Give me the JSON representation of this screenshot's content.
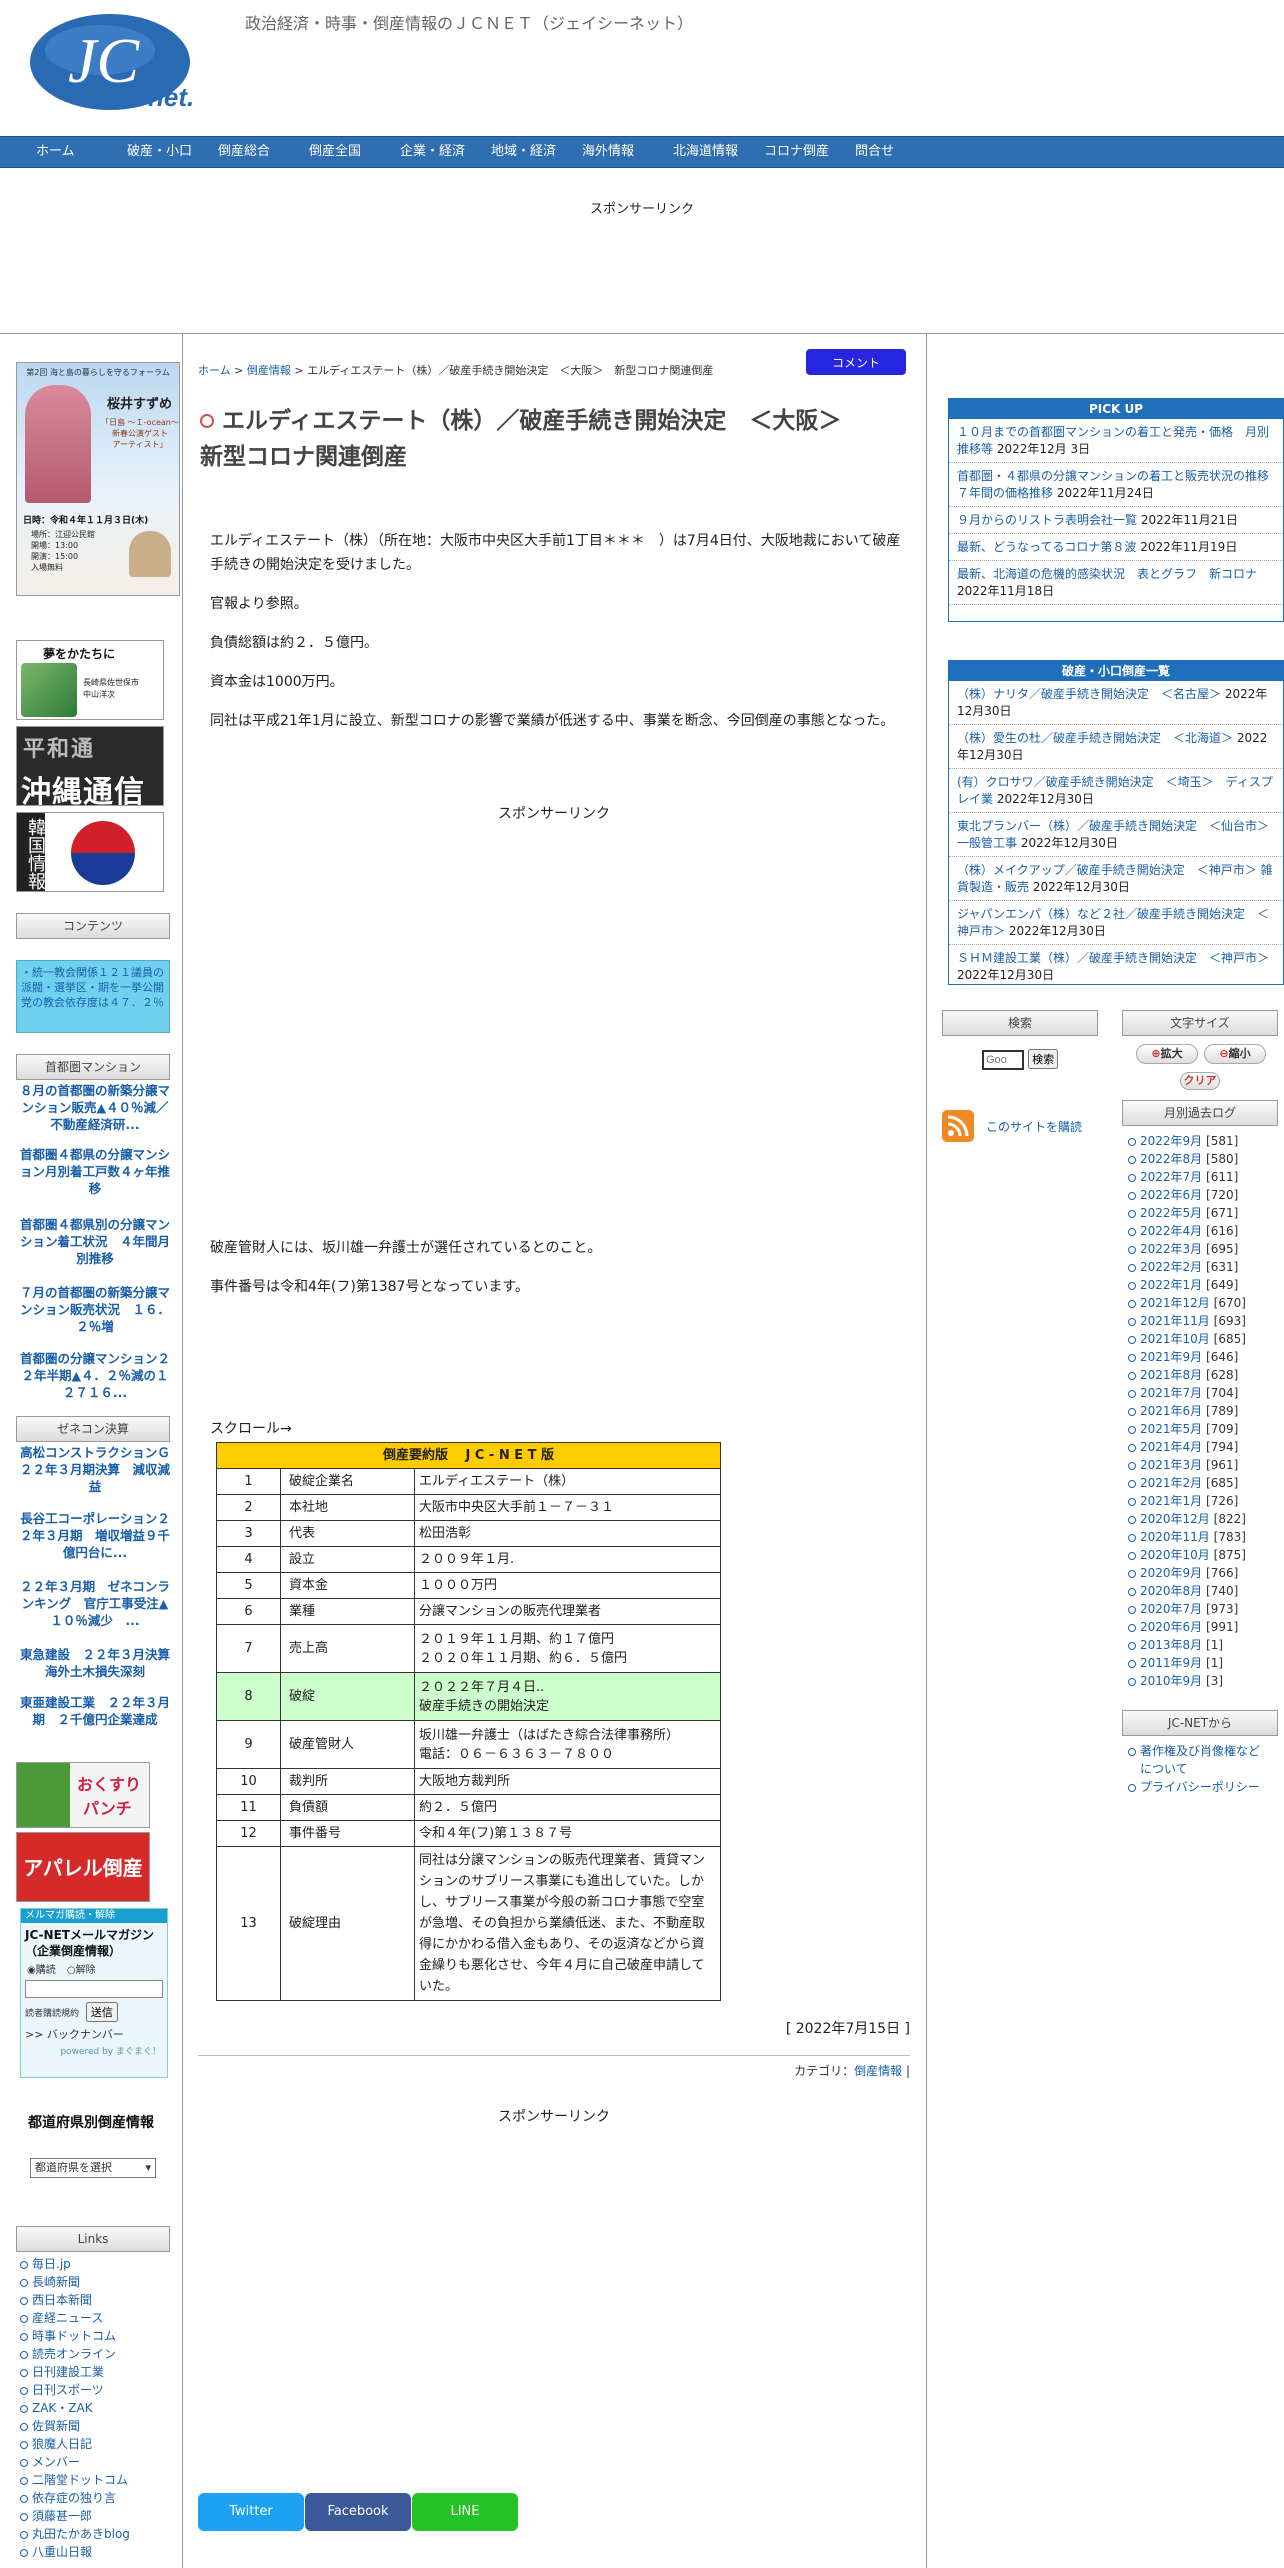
{
  "header": {
    "logo_text": "JC",
    "logo_sub": "net.",
    "tagline": "政治経済・時事・倒産情報のＪＣＮＥＴ（ジェイシーネット）"
  },
  "nav": [
    "ホーム",
    "破産・小口",
    "倒産総合",
    "倒産全国",
    "企業・経済",
    "地域・経済",
    "海外情報",
    "北海道情報",
    "コロナ倒産",
    "問合せ"
  ],
  "sponsor_label": "スポンサーリンク",
  "left": {
    "banner1": {
      "title": "第2回 海と島の暮らしを守るフォーラム",
      "name": "桜井すずめ",
      "sub": "「日島 〜Ｉ-ocean〜\n新春公演ゲスト\nアーティスト」",
      "date": "日時：令和４年１１月３日(木)",
      "place": "場所：江迎公民館",
      "open": "開場：13:00",
      "start": "開演：15:00",
      "fee": "入場無料"
    },
    "banner2": {
      "title": "夢をかたちに",
      "sub": "長崎県佐世保市\n中山洋次"
    },
    "banner3": {
      "line1": "平和通",
      "line2": "沖縄通信"
    },
    "banner4": {
      "text": "韓国情報"
    },
    "contents_head": "コンテンツ",
    "notice_text": "・統一教会関係１２１議員の派閥・選挙区・期を一挙公開　党の教会依存度は４７．２％",
    "mansion_head": "首都圏マンション",
    "mansion_links": [
      "８月の首都圏の新築分譲マンション販売▲４０％減／不動産経済研...",
      "首都圏４都県の分譲マンション月別着工戸数４ヶ年推移",
      "首都圏４都県別の分譲マンション着工状況　４年間月別推移",
      "７月の首都圏の新築分譲マンション販売状況　１６．２％増",
      "首都圏の分譲マンション２２年半期▲４．２％減の１２７１６..."
    ],
    "zenecon_head": "ゼネコン決算",
    "zenecon_links": [
      "高松コンストラクションＧ２２年３月期決算　減収減益",
      "長谷工コーポレーション２２年３月期　増収増益９千億円台に...",
      "２２年３月期　ゼネコンランキング　官庁工事受注▲１０％減少　...",
      "東急建設　２２年３月決算　海外土木損失深刻",
      "東亜建設工業　２２年３月期　２千億円企業達成"
    ],
    "banner5": {
      "line1": "おくすり",
      "line2": "パンチ"
    },
    "banner6": {
      "text": "アパレル倒産"
    },
    "mail": {
      "label": "メルマガ購読・解除",
      "title": "JC-NETメールマガジン（企業倒産情報）",
      "subscribe": "購読",
      "unsubscribe": "解除",
      "terms": "読者購読規約",
      "submit": "送信",
      "backnumber": ">> バックナンバー",
      "powered": "powered by まぐまぐ！"
    },
    "pref_head": "都道府県別倒産情報",
    "pref_select": "都道府県を選択",
    "links_head": "Links",
    "links": [
      "毎日.jp",
      "長崎新聞",
      "西日本新聞",
      "産経ニュース",
      "時事ドットコム",
      "読売オンライン",
      "日刊建設工業",
      "日刊スポーツ",
      "ZAK・ZAK",
      "佐賀新聞",
      "狼魔人日記",
      "メンバー",
      "二階堂ドットコム",
      "依存症の独り言",
      "須藤甚一郎",
      "丸田たかあきblog",
      "八重山日報"
    ]
  },
  "main": {
    "comment_button": "コメント",
    "breadcrumb": {
      "home": "ホーム",
      "sep1": ">",
      "category": "倒産情報",
      "sep2": ">",
      "current": "エルディエステート（株）／破産手続き開始決定　＜大阪＞　新型コロナ関連倒産"
    },
    "title_line1": "エルディエステート（株）／破産手続き開始決定　＜大阪＞",
    "title_line2": "新型コロナ関連倒産",
    "paragraphs": [
      "エルディエステート（株）（所在地：大阪市中央区大手前1丁目＊＊＊　）は7月4日付、大阪地裁において破産手続きの開始決定を受けました。",
      "官報より参照。",
      "負債総額は約２．５億円。",
      "資本金は1000万円。",
      "同社は平成21年1月に設立、新型コロナの影響で業績が低迷する中、事業を断念、今回倒産の事態となった。"
    ],
    "paragraphs2": [
      "破産管財人には、坂川雄一弁護士が選任されているとのこと。",
      "事件番号は令和4年(フ)第1387号となっています。"
    ],
    "scroll_label": "スクロール→",
    "table": {
      "header": "倒産要約版　 J C - N E T 版",
      "rows": [
        {
          "no": "1",
          "label": "破綻企業名",
          "value": "エルディエステート（株）"
        },
        {
          "no": "2",
          "label": "本社地",
          "value": "大阪市中央区大手前１－７－３１"
        },
        {
          "no": "3",
          "label": "代表",
          "value": "松田浩彰"
        },
        {
          "no": "4",
          "label": "設立",
          "value": "２００９年１月."
        },
        {
          "no": "5",
          "label": "資本金",
          "value": "１０００万円"
        },
        {
          "no": "6",
          "label": "業種",
          "value": "分譲マンションの販売代理業者"
        },
        {
          "no": "7",
          "label": "売上高",
          "value": "２０１９年１１月期、約１７億円\n２０２０年１１月期、約６．５億円"
        },
        {
          "no": "8",
          "label": "破綻",
          "value": "２０２２年７月４日..\n破産手続きの開始決定"
        },
        {
          "no": "9",
          "label": "破産管財人",
          "value": "坂川雄一弁護士（はばたき綜合法律事務所）\n電話：０６－６３６３－７８００"
        },
        {
          "no": "10",
          "label": "裁判所",
          "value": "大阪地方裁判所"
        },
        {
          "no": "11",
          "label": "負債額",
          "value": "約２．５億円"
        },
        {
          "no": "12",
          "label": "事件番号",
          "value": "令和４年(フ)第１３８７号"
        },
        {
          "no": "13",
          "label": "破綻理由",
          "value": "同社は分譲マンションの販売代理業者、賃貸マンションのサブリース事業にも進出していた。しかし、サブリース事業が今般の新コロナ事態で空室が急増、その負担から業績低迷、また、不動産取得にかかわる借入金もあり、その返済などから資金繰りも悪化させ、今年４月に自己破産申請していた。"
        }
      ]
    },
    "date": "[ 2022年7月15日 ]",
    "category_label": "カテゴリ：",
    "category_value": "倒産情報",
    "category_end": "|",
    "share": {
      "twitter": "Twitter",
      "facebook": "Facebook",
      "line": "LINE"
    }
  },
  "right": {
    "pickup_head": "PICK UP",
    "pickup": [
      {
        "t": "１０月までの首都圏マンションの着工と発売・価格　月別推移等",
        "d": "2022年12月 3日"
      },
      {
        "t": "首都圏・４都県の分譲マンションの着工と販売状況の推移 ７年間の価格推移",
        "d": "2022年11月24日"
      },
      {
        "t": "９月からのリストラ表明会社一覧",
        "d": "2022年11月21日"
      },
      {
        "t": "最新、どうなってるコロナ第８波",
        "d": "2022年11月19日"
      },
      {
        "t": "最新、北海道の危機的感染状況　表とグラフ　新コロナ",
        "d": "2022年11月18日"
      }
    ],
    "hasan_head": "破産・小口倒産一覧",
    "hasan": [
      {
        "t": "（株）ナリタ／破産手続き開始決定　＜名古屋＞",
        "d": "2022年12月30日"
      },
      {
        "t": "（株）愛生の杜／破産手続き開始決定　＜北海道＞",
        "d": "2022年12月30日"
      },
      {
        "t": "(有）クロサワ／破産手続き開始決定　＜埼玉＞　ディスプレイ業",
        "d": "2022年12月30日"
      },
      {
        "t": "東北プランバー（株）／破産手続き開始決定　＜仙台市＞ 一般管工事",
        "d": "2022年12月30日"
      },
      {
        "t": "（株）メイクアップ／破産手続き開始決定　＜神戸市＞ 雑貨製造・販売",
        "d": "2022年12月30日"
      },
      {
        "t": "ジャパンエンパ（株）など２社／破産手続き開始決定　＜神戸市＞",
        "d": "2022年12月30日"
      },
      {
        "t": "ＳＨＭ建設工業（株）／破産手続き開始決定　＜神戸市＞",
        "d": "2022年12月30日"
      }
    ],
    "search_head": "検索",
    "search_placeholder": "Goo",
    "search_button": "検索",
    "rss_label": "このサイトを購読",
    "fontsize_head": "文字サイズ",
    "font_big": "拡大",
    "font_small": "縮小",
    "font_clear": "クリア",
    "archive_head": "月別過去ログ",
    "archive": [
      {
        "m": "2022年9月",
        "c": "[581]"
      },
      {
        "m": "2022年8月",
        "c": "[580]"
      },
      {
        "m": "2022年7月",
        "c": "[611]"
      },
      {
        "m": "2022年6月",
        "c": "[720]"
      },
      {
        "m": "2022年5月",
        "c": "[671]"
      },
      {
        "m": "2022年4月",
        "c": "[616]"
      },
      {
        "m": "2022年3月",
        "c": "[695]"
      },
      {
        "m": "2022年2月",
        "c": "[631]"
      },
      {
        "m": "2022年1月",
        "c": "[649]"
      },
      {
        "m": "2021年12月",
        "c": "[670]"
      },
      {
        "m": "2021年11月",
        "c": "[693]"
      },
      {
        "m": "2021年10月",
        "c": "[685]"
      },
      {
        "m": "2021年9月",
        "c": "[646]"
      },
      {
        "m": "2021年8月",
        "c": "[628]"
      },
      {
        "m": "2021年7月",
        "c": "[704]"
      },
      {
        "m": "2021年6月",
        "c": "[789]"
      },
      {
        "m": "2021年5月",
        "c": "[709]"
      },
      {
        "m": "2021年4月",
        "c": "[794]"
      },
      {
        "m": "2021年3月",
        "c": "[961]"
      },
      {
        "m": "2021年2月",
        "c": "[685]"
      },
      {
        "m": "2021年1月",
        "c": "[726]"
      },
      {
        "m": "2020年12月",
        "c": "[822]"
      },
      {
        "m": "2020年11月",
        "c": "[783]"
      },
      {
        "m": "2020年10月",
        "c": "[875]"
      },
      {
        "m": "2020年9月",
        "c": "[766]"
      },
      {
        "m": "2020年8月",
        "c": "[740]"
      },
      {
        "m": "2020年7月",
        "c": "[973]"
      },
      {
        "m": "2020年6月",
        "c": "[991]"
      },
      {
        "m": "2013年8月",
        "c": "[1]"
      },
      {
        "m": "2011年9月",
        "c": "[1]"
      },
      {
        "m": "2010年9月",
        "c": "[3]"
      }
    ],
    "jcnet_head": "JC-NETから",
    "jcnet_links": [
      "著作権及び肖像権などについて",
      "プライバシーポリシー"
    ]
  }
}
